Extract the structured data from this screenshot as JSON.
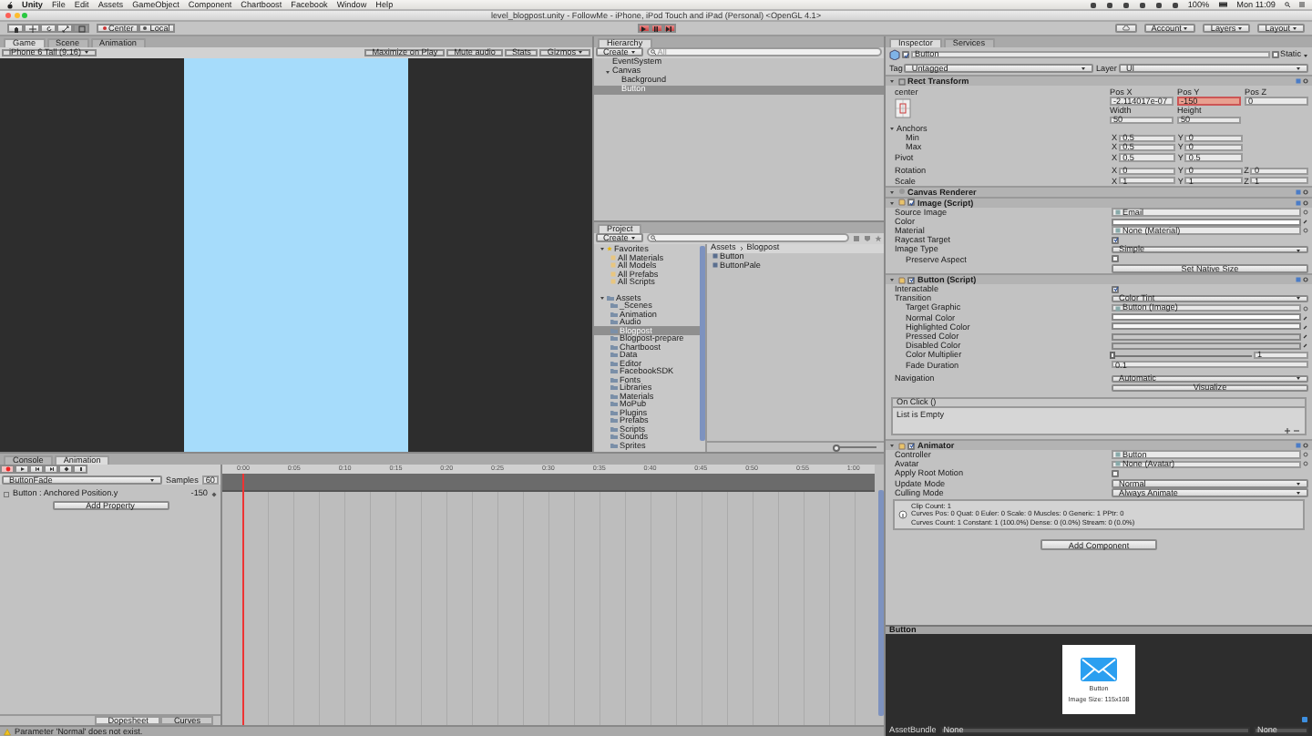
{
  "menu_bar": {
    "items": [
      "Unity",
      "File",
      "Edit",
      "Assets",
      "GameObject",
      "Component",
      "Chartboost",
      "Facebook",
      "Window",
      "Help"
    ],
    "battery": "100%",
    "clock": "Mon 11:09"
  },
  "window": {
    "title": "level_blogpost.unity - FollowMe - iPhone, iPod Touch and iPad (Personal) <OpenGL 4.1>"
  },
  "toolbar": {
    "pivot": "Center",
    "space": "Local",
    "account": "Account",
    "layers": "Layers",
    "layout": "Layout"
  },
  "game_view": {
    "tabs": [
      {
        "label": "Game",
        "selected": true
      },
      {
        "label": "Scene",
        "selected": false
      },
      {
        "label": "Animation",
        "selected": false
      }
    ],
    "aspect": "iPhone 6 Tall (9:16)",
    "options": [
      "Maximize on Play",
      "Mute audio",
      "Stats"
    ],
    "gizmos": "Gizmos"
  },
  "hierarchy": {
    "title": "Hierarchy",
    "create": "Create",
    "search_placeholder": "All",
    "items": [
      {
        "label": "EventSystem",
        "selected": false
      },
      {
        "label": "Canvas",
        "selected": false,
        "expanded": true,
        "children": [
          {
            "label": "Background",
            "selected": false
          },
          {
            "label": "Button",
            "selected": true
          }
        ]
      }
    ]
  },
  "project": {
    "title": "Project",
    "create": "Create",
    "favorites": {
      "label": "Favorites",
      "items": [
        "All Materials",
        "All Models",
        "All Prefabs",
        "All Scripts"
      ]
    },
    "assets": {
      "label": "Assets",
      "items": [
        {
          "label": "_Scenes",
          "selected": false
        },
        {
          "label": "Animation",
          "selected": false
        },
        {
          "label": "Audio",
          "selected": false
        },
        {
          "label": "Blogpost",
          "selected": true
        },
        {
          "label": "Blogpost-prepare",
          "selected": false
        },
        {
          "label": "Chartboost",
          "selected": false
        },
        {
          "label": "Data",
          "selected": false
        },
        {
          "label": "Editor",
          "selected": false
        },
        {
          "label": "FacebookSDK",
          "selected": false
        },
        {
          "label": "Fonts",
          "selected": false
        },
        {
          "label": "Libraries",
          "selected": false
        },
        {
          "label": "Materials",
          "selected": false
        },
        {
          "label": "MoPub",
          "selected": false
        },
        {
          "label": "Plugins",
          "selected": false
        },
        {
          "label": "Prefabs",
          "selected": false
        },
        {
          "label": "Scripts",
          "selected": false
        },
        {
          "label": "Sounds",
          "selected": false
        },
        {
          "label": "Sprites",
          "selected": false
        }
      ]
    },
    "breadcrumb": [
      "Assets",
      "Blogpost"
    ],
    "files": [
      "Button",
      "ButtonPale"
    ],
    "icon_size": {
      "level": 0
    }
  },
  "inspector": {
    "tabs": [
      {
        "label": "Inspector",
        "selected": true
      },
      {
        "label": "Services",
        "selected": false
      }
    ],
    "object": {
      "active": true,
      "name": "Button",
      "static_label": "Static",
      "static": false,
      "tag_label": "Tag",
      "tag": "Untagged",
      "layer_label": "Layer",
      "layer": "UI"
    },
    "components": [
      {
        "kind": "rect_transform",
        "title": "Rect Transform",
        "anchor_preset": "center",
        "rows": [
          {
            "kind": "grid",
            "cells": [
              {
                "caption": "Pos X",
                "value": "-2.114017e-07",
                "recorded": false
              },
              {
                "caption": "Pos Y",
                "value": "-150",
                "recorded": true
              },
              {
                "caption": "Pos Z",
                "value": "0",
                "recorded": false
              }
            ]
          },
          {
            "kind": "grid",
            "cells": [
              {
                "caption": "Width",
                "value": "50",
                "recorded": false
              },
              {
                "caption": "Height",
                "value": "50",
                "recorded": false
              }
            ]
          },
          {
            "kind": "foldout",
            "label": "Anchors",
            "expanded": true
          },
          {
            "kind": "xyz",
            "label": "Min",
            "sub": true,
            "axes": [
              {
                "axis": "X",
                "value": "0.5"
              },
              {
                "axis": "Y",
                "value": "0"
              }
            ]
          },
          {
            "kind": "xyz",
            "label": "Max",
            "sub": true,
            "axes": [
              {
                "axis": "X",
                "value": "0.5"
              },
              {
                "axis": "Y",
                "value": "0"
              }
            ]
          },
          {
            "kind": "xyz",
            "label": "Pivot",
            "sub": false,
            "axes": [
              {
                "axis": "X",
                "value": "0.5"
              },
              {
                "axis": "Y",
                "value": "0.5"
              }
            ]
          },
          {
            "kind": "space"
          },
          {
            "kind": "xyz",
            "label": "Rotation",
            "sub": false,
            "axes": [
              {
                "axis": "X",
                "value": "0"
              },
              {
                "axis": "Y",
                "value": "0"
              },
              {
                "axis": "Z",
                "value": "0"
              }
            ]
          },
          {
            "kind": "xyz",
            "label": "Scale",
            "sub": false,
            "axes": [
              {
                "axis": "X",
                "value": "1"
              },
              {
                "axis": "Y",
                "value": "1"
              },
              {
                "axis": "Z",
                "value": "1"
              }
            ]
          }
        ]
      },
      {
        "kind": "plain",
        "title": "Canvas Renderer"
      },
      {
        "kind": "script",
        "title": "Image (Script)",
        "enabled": true,
        "rows": [
          {
            "kind": "object",
            "label": "Source Image",
            "value": "Email"
          },
          {
            "kind": "color",
            "label": "Color",
            "color": "#ffffff"
          },
          {
            "kind": "object",
            "label": "Material",
            "value": "None (Material)"
          },
          {
            "kind": "check",
            "label": "Raycast Target",
            "checked": true
          },
          {
            "kind": "dropdown",
            "label": "Image Type",
            "value": "Simple"
          },
          {
            "kind": "check",
            "label": "Preserve Aspect",
            "checked": false,
            "sub": true
          },
          {
            "kind": "button",
            "label": "Set Native Size"
          }
        ]
      },
      {
        "kind": "script",
        "title": "Button (Script)",
        "enabled": true,
        "rows": [
          {
            "kind": "check",
            "label": "Interactable",
            "checked": true
          },
          {
            "kind": "dropdown",
            "label": "Transition",
            "value": "Color Tint"
          },
          {
            "kind": "object",
            "label": "Target Graphic",
            "value": "Button (Image)",
            "sub": true
          },
          {
            "kind": "color",
            "label": "Normal Color",
            "color": "#ffffff",
            "sub": true
          },
          {
            "kind": "color",
            "label": "Highlighted Color",
            "color": "#f5f5f5",
            "sub": true
          },
          {
            "kind": "color",
            "label": "Pressed Color",
            "color": "#c8c8c8",
            "sub": true
          },
          {
            "kind": "color",
            "label": "Disabled Color",
            "color": "#c8c8c8",
            "sub": true
          },
          {
            "kind": "slider",
            "label": "Color Multiplier",
            "level": 0,
            "value": "1",
            "sub": true
          },
          {
            "kind": "text",
            "label": "Fade Duration",
            "value": "0.1",
            "sub": true
          },
          {
            "kind": "space"
          },
          {
            "kind": "dropdown",
            "label": "Navigation",
            "value": "Automatic"
          },
          {
            "kind": "button",
            "label": "Visualize"
          },
          {
            "kind": "event",
            "label": "On Click ()",
            "value": "List is Empty"
          }
        ]
      },
      {
        "kind": "script",
        "title": "Animator",
        "enabled": true,
        "rows": [
          {
            "kind": "object",
            "label": "Controller",
            "value": "Button"
          },
          {
            "kind": "object",
            "label": "Avatar",
            "value": "None (Avatar)"
          },
          {
            "kind": "check",
            "label": "Apply Root Motion",
            "checked": false
          },
          {
            "kind": "dropdown",
            "label": "Update Mode",
            "value": "Normal"
          },
          {
            "kind": "dropdown",
            "label": "Culling Mode",
            "value": "Always Animate"
          },
          {
            "kind": "info",
            "lines": [
              "Clip Count: 1",
              "Curves Pos: 0 Quat: 0 Euler: 0 Scale: 0 Muscles: 0 Generic: 1 PPtr: 0",
              "Curves Count: 1 Constant: 1 (100.0%) Dense: 0 (0.0%) Stream: 0 (0.0%)"
            ]
          }
        ]
      }
    ],
    "add_component": "Add Component"
  },
  "preview": {
    "title": "Button",
    "caption": [
      "Button",
      "Image Size: 115x108"
    ],
    "asset_bundle": "AssetBundle",
    "bundle": "None",
    "variant": "None"
  },
  "animation": {
    "tabs": [
      {
        "label": "Console",
        "selected": false
      },
      {
        "label": "Animation",
        "selected": true
      }
    ],
    "recording": true,
    "clip": "ButtonFade",
    "samples_label": "Samples",
    "samples": "60",
    "properties": [
      {
        "label": "Button : Anchored Position.y",
        "value": "-150"
      }
    ],
    "add_property": "Add Property",
    "ticks": [
      "0:00",
      "0:05",
      "0:10",
      "0:15",
      "0:20",
      "0:25",
      "0:30",
      "0:35",
      "0:40",
      "0:45",
      "0:50",
      "0:55",
      "1:00"
    ],
    "views": [
      {
        "label": "Dopesheet",
        "selected": true
      },
      {
        "label": "Curves",
        "selected": false
      }
    ]
  },
  "status_bar": {
    "message": "Parameter 'Normal' does not exist."
  }
}
